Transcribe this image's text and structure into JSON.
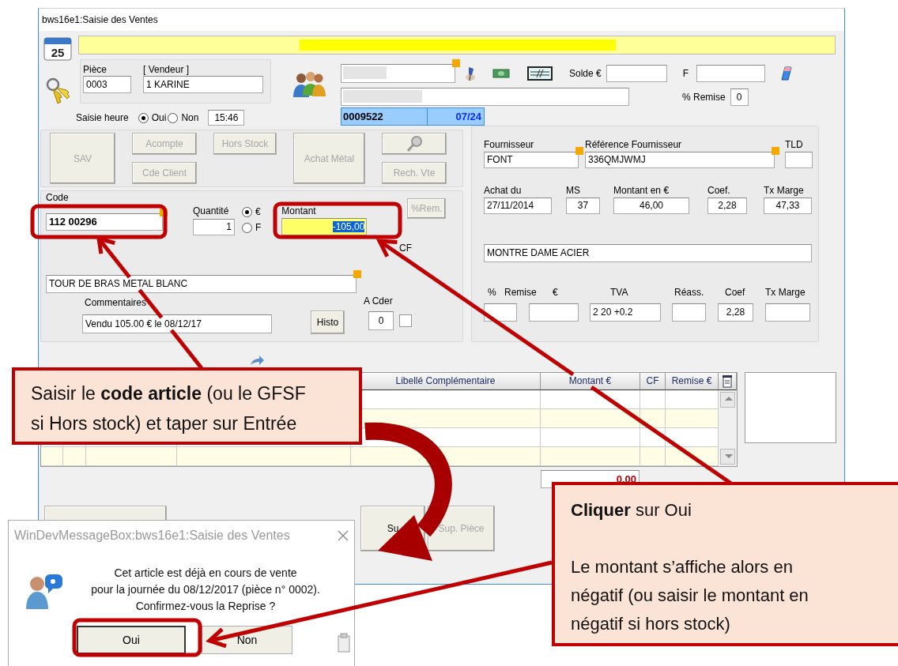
{
  "window": {
    "title": "bws16e1:Saisie des Ventes"
  },
  "calendar_day": "25",
  "piece": {
    "label": "Pièce",
    "value": "0003"
  },
  "vendeur": {
    "label": "[ Vendeur ]",
    "value": "1  KARINE"
  },
  "saisie_heure": {
    "label": "Saisie heure",
    "options": [
      {
        "label": "Oui",
        "selected": true
      },
      {
        "label": "Non",
        "selected": false
      }
    ],
    "time": "15:46"
  },
  "client": {
    "solde_label": "Solde €",
    "f_label": "F",
    "remise_label": "% Remise",
    "remise": "0",
    "ticket": "0009522",
    "period": "07/24"
  },
  "action_buttons": [
    {
      "kind": "text",
      "label": "SAV",
      "disabled": true
    },
    {
      "kind": "text",
      "label": "Acompte",
      "disabled": true
    },
    {
      "kind": "text",
      "label": "Cde Client",
      "disabled": true
    },
    {
      "kind": "text",
      "label": "Hors Stock",
      "disabled": true
    },
    {
      "kind": "text",
      "label": "Achat Métal",
      "disabled": true
    },
    {
      "kind": "icon",
      "disabled": true
    },
    {
      "kind": "text",
      "label": "Rech. Vte",
      "disabled": true
    }
  ],
  "article": {
    "code_label": "Code",
    "code": "112 00296",
    "quantite_label": "Quantité",
    "quantite": "1",
    "currency": [
      {
        "label": "€",
        "selected": true
      },
      {
        "label": "F",
        "selected": false
      }
    ],
    "montant_label": "Montant",
    "montant": "-105,00",
    "rem_button": {
      "label": "%Rem.",
      "disabled": true
    },
    "cf_label": "CF",
    "libelle": "TOUR DE BRAS METAL BLANC",
    "commentaires_label": "Commentaires",
    "commentaire": "Vendu 105.00 € le 08/12/17",
    "histo_button": "Histo",
    "a_cder_label": "A Cder",
    "a_cder": "0",
    "a_cder_checked": false
  },
  "supplier": {
    "row1": [
      {
        "label": "Fournisseur",
        "value": "FONT"
      },
      {
        "label": "Référence Fournisseur",
        "value": "336QMJWMJ"
      },
      {
        "label": "TLD"
      }
    ],
    "row2": [
      {
        "label": "Achat du",
        "value": "27/11/2014"
      },
      {
        "label": "MS",
        "value": "37"
      },
      {
        "label": "Montant en €",
        "value": "46,00"
      },
      {
        "label": "Coef.",
        "value": "2,28"
      },
      {
        "label": "Tx Marge",
        "value": "47,33"
      }
    ],
    "description": "MONTRE DAME ACIER",
    "row4_labels": [
      "%",
      "Remise",
      "€",
      "TVA",
      "Réass.",
      "Coef",
      "Tx Marge"
    ],
    "row4_fields": [
      {
        "kind": "blank"
      },
      {
        "kind": "blank"
      },
      {
        "kind": "filled",
        "value": "2   20 +0.2"
      },
      {
        "kind": "blank"
      },
      {
        "kind": "filled",
        "value": "2,28"
      },
      {
        "kind": "blank"
      }
    ]
  },
  "table": {
    "columns": [
      {
        "label": "Libellé Complémentaire"
      },
      {
        "label": "Montant €"
      },
      {
        "label": "CF"
      },
      {
        "label": "Remise €"
      }
    ],
    "total": "0.00"
  },
  "bottom_buttons": [
    {
      "label": "Su",
      "disabled": false
    },
    {
      "label": "Sup. Pièce",
      "disabled": true
    }
  ],
  "message_box": {
    "title": "WinDevMessageBox:bws16e1:Saisie des Ventes",
    "lines": [
      "Cet article est déjà en cours de vente",
      "pour la journée du 08/12/2017 (pièce n° 0002).",
      "Confirmez-vous la Reprise ?"
    ],
    "buttons": [
      {
        "label": "Oui",
        "selected": true
      },
      {
        "label": "Non",
        "selected": false
      }
    ]
  },
  "callouts": [
    {
      "paragraphs": [
        "Saisir le **code article** (ou le GFSF si Hors stock) et taper sur Entrée"
      ]
    },
    {
      "paragraphs": [
        "**Cliquer** sur Oui",
        "Le montant s’affiche alors en négatif (ou saisir le montant en négatif si hors stock)"
      ]
    }
  ]
}
